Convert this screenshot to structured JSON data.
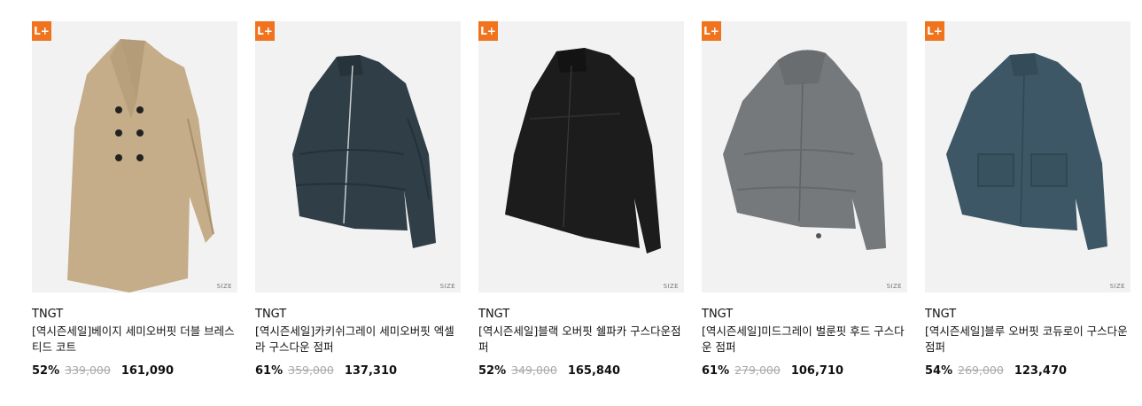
{
  "badge_label": "L+",
  "colors": {
    "badge": "#f0731e",
    "image_bg": "#f2f2f2"
  },
  "products": [
    {
      "brand": "TNGT",
      "title": "[역시즌세일]베이지 세미오버핏 더블 브레스티드 코트",
      "discount": "52%",
      "original_price": "339,000",
      "sale_price": "161,090",
      "size_label": "SIZE",
      "image_icon": "beige-coat-image",
      "image_color": "#c4ad88"
    },
    {
      "brand": "TNGT",
      "title": "[역시즌세일]카키쉬그레이 세미오버핏 엑셀라 구스다운 점퍼",
      "discount": "61%",
      "original_price": "359,000",
      "sale_price": "137,310",
      "size_label": "SIZE",
      "image_icon": "navy-puffer-image",
      "image_color": "#2f3e47"
    },
    {
      "brand": "TNGT",
      "title": "[역시즌세일]블랙 오버핏 쉘파카 구스다운점퍼",
      "discount": "52%",
      "original_price": "349,000",
      "sale_price": "165,840",
      "size_label": "SIZE",
      "image_icon": "black-parka-image",
      "image_color": "#1c1c1c"
    },
    {
      "brand": "TNGT",
      "title": "[역시즌세일]미드그레이 벌룬핏 후드 구스다운 점퍼",
      "discount": "61%",
      "original_price": "279,000",
      "sale_price": "106,710",
      "size_label": "SIZE",
      "image_icon": "grey-hooded-puffer-image",
      "image_color": "#76797b"
    },
    {
      "brand": "TNGT",
      "title": "[역시즌세일]블루 오버핏 코듀로이 구스다운 점퍼",
      "discount": "54%",
      "original_price": "269,000",
      "sale_price": "123,470",
      "size_label": "SIZE",
      "image_icon": "blue-corduroy-jacket-image",
      "image_color": "#3d5766"
    }
  ]
}
